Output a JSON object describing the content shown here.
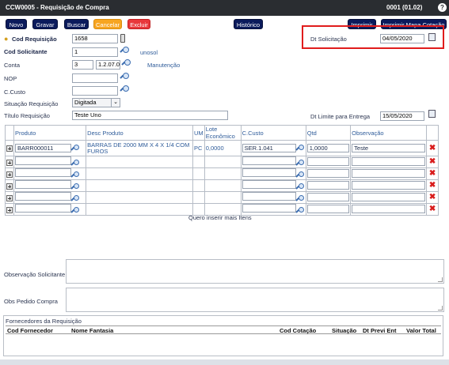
{
  "window": {
    "title": "CCW0005 - Requisição de Compra",
    "code": "0001 (01.02)",
    "help": "?"
  },
  "toolbar": {
    "novo": "Novo",
    "gravar": "Gravar",
    "buscar": "Buscar",
    "cancelar": "Cancelar",
    "excluir": "Excluir",
    "historico": "Histórico",
    "imprimir": "Imprimir",
    "imprimir_mapa": "Imprimir Mapa Cotação"
  },
  "form": {
    "cod_requisicao_label": "Cod Requisição",
    "cod_requisicao": "1658",
    "cod_solicitante_label": "Cod Solicitante",
    "cod_solicitante": "1",
    "solicitante_nome": "unosol",
    "conta_label": "Conta",
    "conta_a": "3",
    "conta_b": "1.2.07.0",
    "conta_desc": "Manutenção",
    "nop_label": "NOP",
    "nop": "",
    "ccusto_label": "C.Custo",
    "ccusto": "",
    "situacao_label": "Situação Requisição",
    "situacao": "Digitada",
    "titulo_label": "Título Requisição",
    "titulo": "Teste Uno",
    "dt_solicitacao_label": "Dt Solicitação",
    "dt_solicitacao": "04/05/2020",
    "dt_limite_label": "Dt Limite para Entrega",
    "dt_limite": "15/05/2020"
  },
  "grid": {
    "headers": [
      "Produto",
      "Desc Produto",
      "UM",
      "Lote Econômico",
      "C.Custo",
      "Qtd",
      "Observação"
    ],
    "rows": [
      {
        "produto": "BARR000011",
        "desc": "BARRAS DE 2000 MM X 4 X 1/4 COM FUROS",
        "um": "PC",
        "lote": "0,0000",
        "ccusto": "SER.1.041",
        "qtd": "1,0000",
        "obs": "Teste"
      },
      {
        "produto": "",
        "desc": "",
        "um": "",
        "lote": "",
        "ccusto": "",
        "qtd": "",
        "obs": ""
      },
      {
        "produto": "",
        "desc": "",
        "um": "",
        "lote": "",
        "ccusto": "",
        "qtd": "",
        "obs": ""
      },
      {
        "produto": "",
        "desc": "",
        "um": "",
        "lote": "",
        "ccusto": "",
        "qtd": "",
        "obs": ""
      },
      {
        "produto": "",
        "desc": "",
        "um": "",
        "lote": "",
        "ccusto": "",
        "qtd": "",
        "obs": ""
      },
      {
        "produto": "",
        "desc": "",
        "um": "",
        "lote": "",
        "ccusto": "",
        "qtd": "",
        "obs": ""
      }
    ],
    "more_items": "Quero inserir mais Itens"
  },
  "observacao_solicitante_label": "Observação Solicitante",
  "obs_pedido_label": "Obs Pedido Compra",
  "fornecedores": {
    "title": "Fornecedores da Requisição",
    "headers": [
      "Cod Fornecedor",
      "Nome Fantasia",
      "Cod Cotação",
      "Situação",
      "Dt Previ Ent",
      "Valor Total"
    ]
  },
  "colors": {
    "titlebar": "#2a2d31",
    "button": "#0b1b5c",
    "cancel": "#f7a521",
    "delete": "#e8383b",
    "highlight": "#e01c1c"
  }
}
